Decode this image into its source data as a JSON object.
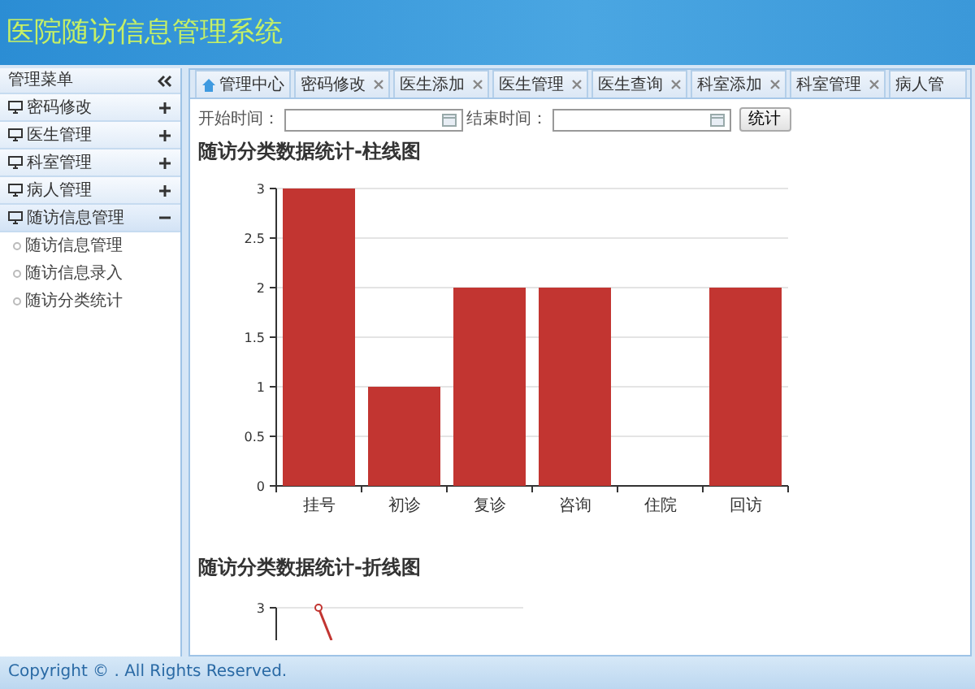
{
  "header": {
    "title": "医院随访信息管理系统"
  },
  "sidebar": {
    "title": "管理菜单",
    "items": [
      {
        "label": "密码修改",
        "expanded": false
      },
      {
        "label": "医生管理",
        "expanded": false
      },
      {
        "label": "科室管理",
        "expanded": false
      },
      {
        "label": "病人管理",
        "expanded": false
      },
      {
        "label": "随访信息管理",
        "expanded": true,
        "children": [
          {
            "label": "随访信息管理"
          },
          {
            "label": "随访信息录入"
          },
          {
            "label": "随访分类统计"
          }
        ]
      }
    ]
  },
  "tabs": [
    {
      "label": "管理中心",
      "kind": "home",
      "selected": false
    },
    {
      "label": "密码修改",
      "kind": "closable",
      "selected": false
    },
    {
      "label": "医生添加",
      "kind": "closable",
      "selected": false
    },
    {
      "label": "医生管理",
      "kind": "closable",
      "selected": false
    },
    {
      "label": "医生查询",
      "kind": "closable",
      "selected": false
    },
    {
      "label": "科室添加",
      "kind": "closable",
      "selected": false
    },
    {
      "label": "科室管理",
      "kind": "closable",
      "selected": false
    },
    {
      "label": "病人管",
      "kind": "plain",
      "selected": false
    }
  ],
  "filter": {
    "start_label": "开始时间：",
    "end_label": "结束时间：",
    "button": "统计"
  },
  "bar_section": {
    "title": "随访分类数据统计-柱线图",
    "chart_data": {
      "type": "bar",
      "categories": [
        "挂号",
        "初诊",
        "复诊",
        "咨询",
        "住院",
        "回访"
      ],
      "series": [
        {
          "color": "#c23531",
          "values": [
            3,
            1,
            2,
            2,
            0,
            2
          ]
        }
      ],
      "grid": true,
      "ylim": [
        0,
        3
      ],
      "yticks": [
        0,
        0.5,
        1,
        1.5,
        2,
        2.5,
        3
      ]
    }
  },
  "line_section": {
    "title": "随访分类数据统计-折线图",
    "ytick_label": "3"
  },
  "footer": {
    "text": "Copyright © . All Rights Reserved."
  }
}
